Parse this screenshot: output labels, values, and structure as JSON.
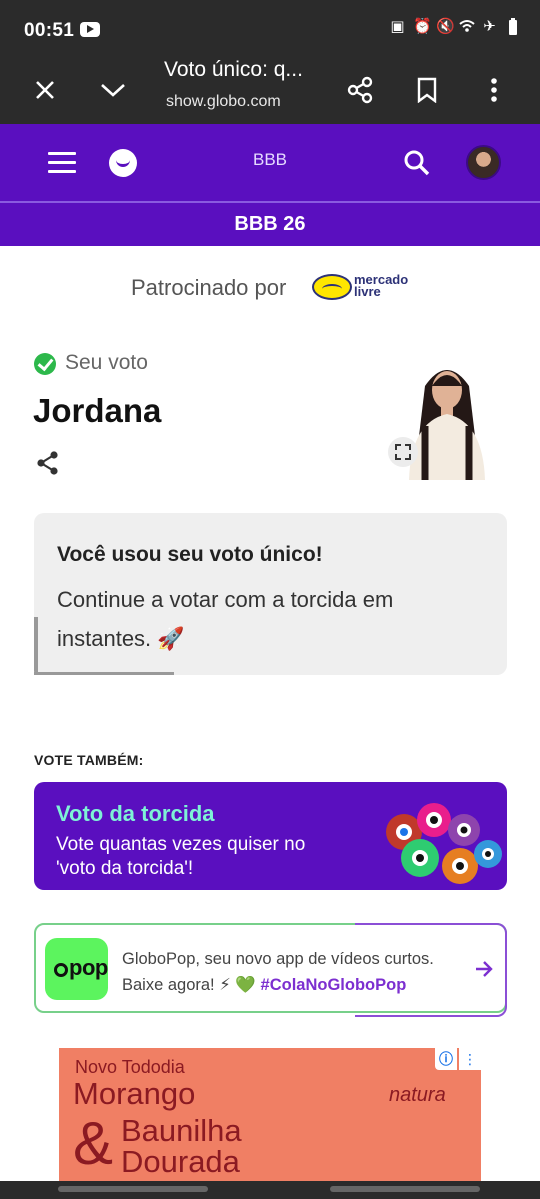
{
  "status_bar": {
    "time": "00:51",
    "icons": [
      "youtube-icon",
      "battery-saver-icon",
      "alarm-icon",
      "mute-icon",
      "wifi-icon",
      "airplane-icon",
      "battery-icon"
    ]
  },
  "browser": {
    "title": "Voto único: q...",
    "url": "show.globo.com"
  },
  "header": {
    "site": "BBB",
    "section": "BBB 26"
  },
  "sponsor": {
    "label": "Patrocinado por",
    "brand_line1": "mercado",
    "brand_line2": "livre"
  },
  "vote": {
    "status": "Seu voto",
    "name": "Jordana"
  },
  "info_card": {
    "heading": "Você usou seu voto único!",
    "body": "Continue a votar com a torcida em instantes. 🚀"
  },
  "vote_also": {
    "label": "VOTE TAMBÉM:"
  },
  "torcida": {
    "title": "Voto da torcida",
    "subtitle": "Vote quantas vezes quiser no 'voto da torcida'!"
  },
  "globopop": {
    "badge_text": "pop",
    "text": "GloboPop, seu novo app de vídeos curtos. Baixe agora! ⚡ 💚",
    "hashtag": "#ColaNoGloboPop"
  },
  "ad": {
    "line1": "Novo Tododia",
    "line2": "Morango",
    "amp": "&",
    "line3": "Baunilha",
    "line4": "Dourada",
    "brand": "natura"
  },
  "colors": {
    "purple": "#5a0fbf",
    "mint": "#7ef2d6",
    "green_badge": "#5cf45e",
    "ad_bg": "#f07f64"
  }
}
